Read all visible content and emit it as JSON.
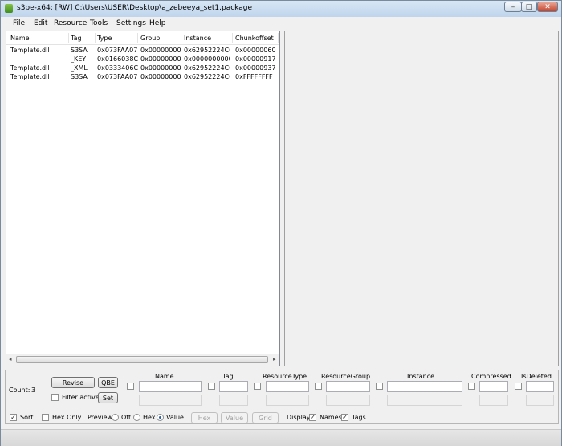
{
  "window": {
    "title": "s3pe-x64: [RW] C:\\Users\\USER\\Desktop\\a_zebeeya_set1.package",
    "min": "–",
    "max": "□",
    "close": "✕"
  },
  "menu": [
    "File",
    "Edit",
    "Resource",
    "Tools",
    "Settings",
    "Help"
  ],
  "list": {
    "headers": [
      "Name",
      "Tag",
      "Type",
      "Group",
      "Instance",
      "Chunkoffset"
    ],
    "rows": [
      {
        "name": "Template.dll",
        "tag": "S3SA",
        "type": "0x073FAA07",
        "group": "0x00000000",
        "instance": "0x62952224C0...",
        "chunk": "0x00000060",
        "deleted": true
      },
      {
        "name": "",
        "tag": "_KEY",
        "type": "0x0166038C",
        "group": "0x00000000",
        "instance": "0x0000000000...",
        "chunk": "0x00000917",
        "deleted": false
      },
      {
        "name": "Template.dll",
        "tag": "_XML",
        "type": "0x0333406C",
        "group": "0x00000000",
        "instance": "0x62952224C0...",
        "chunk": "0x00000937",
        "deleted": false
      },
      {
        "name": "Template.dll",
        "tag": "S3SA",
        "type": "0x073FAA07",
        "group": "0x00000000",
        "instance": "0x62952224C0...",
        "chunk": "0xFFFFFFFF",
        "deleted": false
      }
    ],
    "scroll_left": "◂",
    "scroll_right": "▸"
  },
  "filter": {
    "count_label": "Count:",
    "count_value": "3",
    "revise": "Revise",
    "qbe": "QBE",
    "filter_active": "Filter active",
    "set": "Set",
    "columns": [
      "Name",
      "Tag",
      "ResourceType",
      "ResourceGroup",
      "Instance",
      "Compressed",
      "IsDeleted"
    ]
  },
  "options": {
    "sort": "Sort",
    "sort_checked": true,
    "hex_only": "Hex Only",
    "hex_only_checked": false,
    "preview_label": "Preview:",
    "preview_off": "Off",
    "preview_hex": "Hex",
    "preview_value": "Value",
    "preview_selected": "Value",
    "btn_hex": "Hex",
    "btn_value": "Value",
    "btn_grid": "Grid",
    "display_label": "Display:",
    "names": "Names",
    "names_checked": true,
    "tags": "Tags",
    "tags_checked": true
  }
}
